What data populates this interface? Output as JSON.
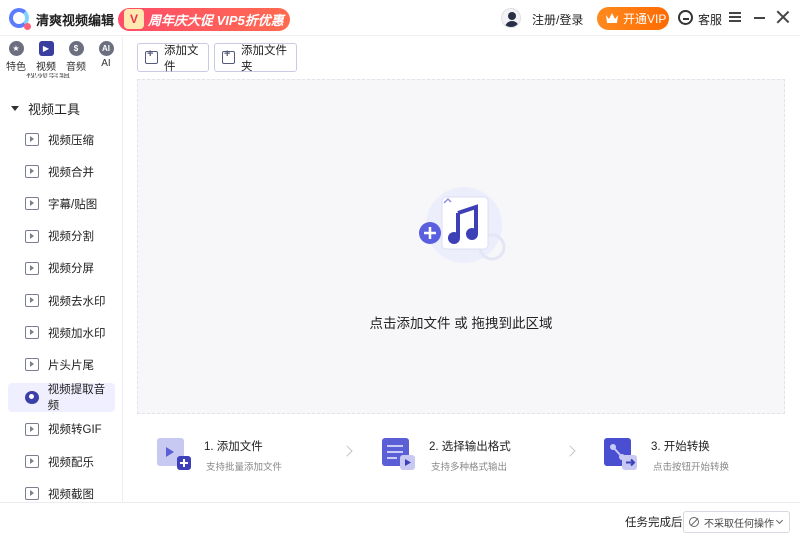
{
  "titlebar": {
    "app_title": "清爽视频编辑",
    "promo_badge": "V",
    "promo_text": "周年庆大促 VIP5折优惠",
    "login": "注册/登录",
    "vip_button": "开通VIP",
    "service": "客服"
  },
  "sidebar": {
    "categories": [
      {
        "label": "特色",
        "icon": "star-icon",
        "glyph": "★"
      },
      {
        "label": "视频",
        "icon": "video-icon",
        "glyph": "▶"
      },
      {
        "label": "音频",
        "icon": "audio-icon",
        "glyph": "$"
      },
      {
        "label": "AI",
        "icon": "ai-icon",
        "glyph": "AI"
      }
    ],
    "cut_item": "视频剪辑",
    "group": "视频工具",
    "items": [
      {
        "label": "视频压缩"
      },
      {
        "label": "视频合并"
      },
      {
        "label": "字幕/贴图"
      },
      {
        "label": "视频分割"
      },
      {
        "label": "视频分屏"
      },
      {
        "label": "视频去水印"
      },
      {
        "label": "视频加水印"
      },
      {
        "label": "片头片尾"
      },
      {
        "label": "视频提取音频"
      },
      {
        "label": "视频转GIF"
      },
      {
        "label": "视频配乐"
      },
      {
        "label": "视频截图"
      }
    ],
    "active_index": 8
  },
  "toolbar": {
    "add_file": "添加文件",
    "add_folder": "添加文件夹"
  },
  "dropzone": {
    "text": "点击添加文件 或 拖拽到此区域"
  },
  "steps": [
    {
      "title": "1. 添加文件",
      "subtitle": "支持批量添加文件"
    },
    {
      "title": "2. 选择输出格式",
      "subtitle": "支持多种格式输出"
    },
    {
      "title": "3. 开始转换",
      "subtitle": "点击按钮开始转换"
    }
  ],
  "bottombar": {
    "after_label": "任务完成后",
    "after_value": "不采取任何操作"
  },
  "colors": {
    "accent": "#4a4fd6",
    "promo": "#ff4d6a",
    "vip": "#ff7a12",
    "active_bg": "#f0efff"
  }
}
